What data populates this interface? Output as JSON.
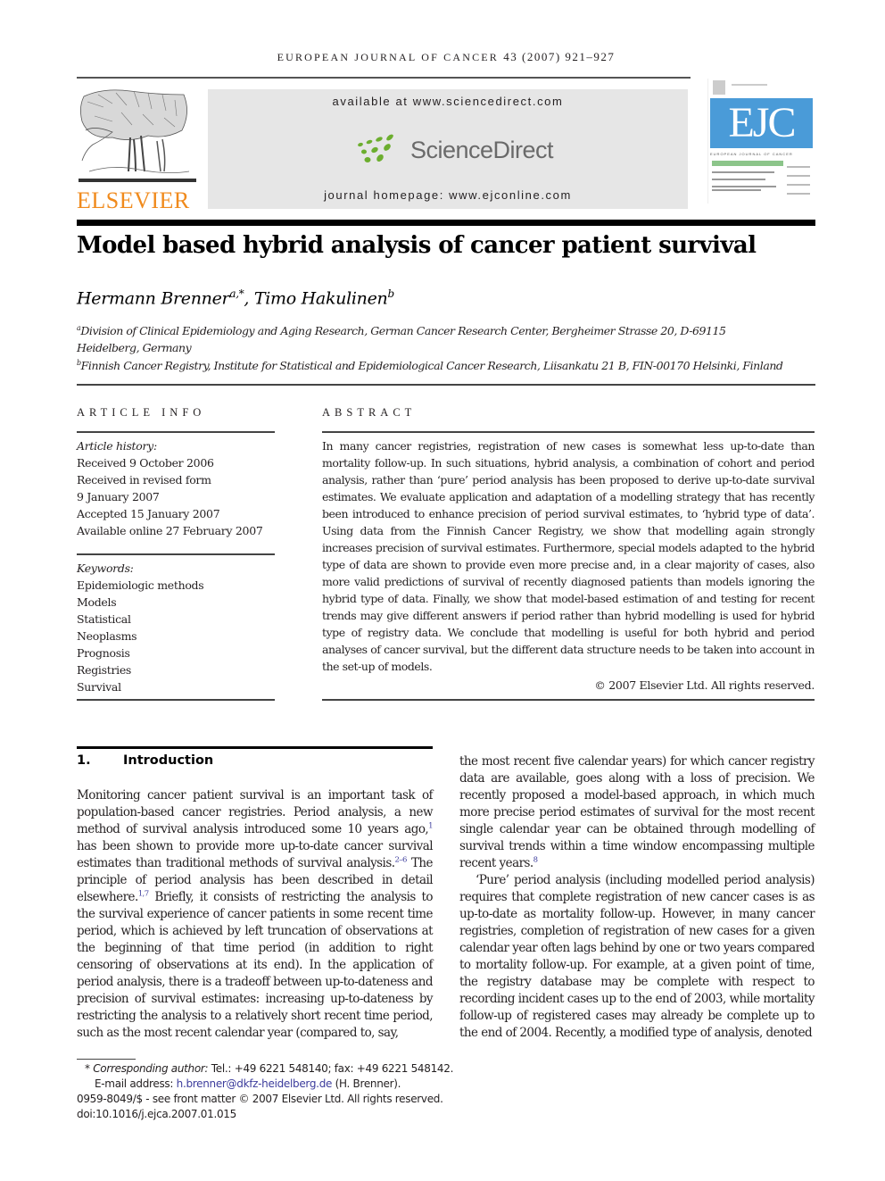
{
  "header": {
    "journal_name": "EUROPEAN JOURNAL OF CANCER",
    "citation": "43 (2007) 921–927",
    "available_at": "available at www.sciencedirect.com",
    "sciencedirect_logo": "ScienceDirect",
    "journal_homepage": "journal homepage: www.ejconline.com",
    "publisher_logo": "ELSEVIER",
    "cover_title": "EJC",
    "cover_subtitle": "EUROPEAN JOURNAL OF CANCER",
    "colors": {
      "elsevier_orange": "#f08a1c",
      "ejc_blue": "#4a9bd8",
      "sd_green": "#6cae2e",
      "sd_band": "#e6e6e6",
      "link": "#3c3c9c"
    }
  },
  "article": {
    "title": "Model based hybrid analysis of cancer patient survival",
    "authors": [
      {
        "name": "Hermann Brenner",
        "sup": "a,*"
      },
      {
        "separator": ", "
      },
      {
        "name": "Timo Hakulinen",
        "sup": "b"
      }
    ],
    "affiliations": [
      {
        "mark": "a",
        "line1": "Division of Clinical Epidemiology and Aging Research, German Cancer Research Center, Bergheimer Strasse 20, D-69115",
        "line2": "Heidelberg, Germany"
      },
      {
        "mark": "b",
        "line1": "Finnish Cancer Registry, Institute for Statistical and Epidemiological Cancer Research, Liisankatu 21 B, FIN-00170 Helsinki, Finland"
      }
    ]
  },
  "article_info": {
    "heading": "ARTICLE INFO",
    "history_label": "Article history:",
    "history": [
      "Received 9 October 2006",
      "Received in revised form",
      "9 January 2007",
      "Accepted 15 January 2007",
      "Available online 27 February 2007"
    ],
    "keywords_label": "Keywords:",
    "keywords": [
      "Epidemiologic methods",
      "Models",
      "Statistical",
      "Neoplasms",
      "Prognosis",
      "Registries",
      "Survival"
    ]
  },
  "abstract": {
    "heading": "ABSTRACT",
    "text": "In many cancer registries, registration of new cases is somewhat less up-to-date than mortality follow-up. In such situations, hybrid analysis, a combination of cohort and period analysis, rather than ‘pure’ period analysis has been proposed to derive up-to-date survival estimates. We evaluate application and adaptation of a modelling strategy that has recently been introduced to enhance precision of period survival estimates, to ‘hybrid type of data’. Using data from the Finnish Cancer Registry, we show that modelling again strongly increases precision of survival estimates. Furthermore, special models adapted to the hybrid type of data are shown to provide even more precise and, in a clear majority of cases, also more valid predictions of survival of recently diagnosed patients than models ignoring the hybrid type of data. Finally, we show that model-based estimation of and testing for recent trends may give different answers if period rather than hybrid modelling is used for hybrid type of registry data. We conclude that modelling is useful for both hybrid and period analyses of cancer survival, but the different data structure needs to be taken into account in the set-up of models.",
    "copyright": "© 2007 Elsevier Ltd. All rights reserved."
  },
  "introduction": {
    "number": "1.",
    "heading": "Introduction",
    "col1": {
      "t1": "Monitoring cancer patient survival is an important task of population-based cancer registries. Period analysis, a new method of survival analysis introduced some 10 years ago,",
      "r1": "1",
      "t2": " has been shown to provide more up-to-date cancer survival estimates than traditional methods of survival analysis.",
      "r2": "2–6",
      "t3": " The principle of period analysis has been described in detail elsewhere.",
      "r3": "1,7",
      "t4": " Briefly, it consists of restricting the analysis to the survival experience of cancer patients in some recent time period, which is achieved by left truncation of observations at the beginning of that time period (in addition to right censoring of observations at its end). In the application of period analysis, there is a tradeoff between up-to-dateness and precision of survival estimates: increasing up-to-dateness by restricting the analysis to a relatively short recent time period, such as the most recent calendar year (compared to, say,"
    },
    "col2": {
      "p1_text": "the most recent five calendar years) for which cancer registry data are available, goes along with a loss of precision. We recently proposed a model-based approach, in which much more precise period estimates of survival for the most recent single calendar year can be obtained through modelling of survival trends within a time window encompassing multiple recent years.",
      "p1_ref": "8",
      "p2_text": "‘Pure’ period analysis (including modelled period analysis) requires that complete registration of new cancer cases is as up-to-date as mortality follow-up. However, in many cancer registries, completion of registration of new cases for a given calendar year often lags behind by one or two years compared to mortality follow-up. For example, at a given point of time, the registry database may be complete with respect to recording incident cases up to the end of 2003, while mortality follow-up of registered cases may already be complete up to the end of 2004. Recently, a modified type of analysis, denoted"
    }
  },
  "footnotes": {
    "star": "*",
    "corresponding_label": "Corresponding author:",
    "corresponding_text": " Tel.: +49 6221 548140; fax: +49 6221 548142.",
    "email_label": "E-mail address: ",
    "email": "h.brenner@dkfz-heidelberg.de",
    "email_suffix": " (H. Brenner).",
    "issn_line": "0959-8049/$ - see front matter © 2007 Elsevier Ltd. All rights reserved.",
    "doi": "doi:10.1016/j.ejca.2007.01.015"
  }
}
